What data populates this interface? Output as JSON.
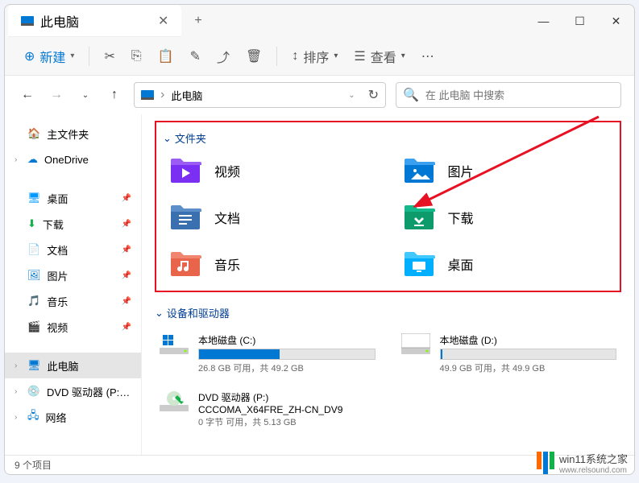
{
  "title": "此电脑",
  "toolbar": {
    "new": "新建",
    "sort": "排序",
    "view": "查看"
  },
  "addressbar": {
    "path": "此电脑",
    "sep": "›"
  },
  "search": {
    "placeholder": "在 此电脑 中搜索"
  },
  "sidebar": {
    "home": "主文件夹",
    "onedrive": "OneDrive",
    "desktop": "桌面",
    "downloads": "下载",
    "documents": "文档",
    "pictures": "图片",
    "music": "音乐",
    "videos": "视频",
    "thispc": "此电脑",
    "dvd": "DVD 驱动器 (P:) C",
    "network": "网络"
  },
  "sections": {
    "folders": "文件夹",
    "devices": "设备和驱动器"
  },
  "folders": {
    "videos": "视频",
    "pictures": "图片",
    "documents": "文档",
    "downloads": "下载",
    "music": "音乐",
    "desktop": "桌面"
  },
  "drives": [
    {
      "name": "本地磁盘 (C:)",
      "info": "26.8 GB 可用，共 49.2 GB",
      "used_pct": 46
    },
    {
      "name": "本地磁盘 (D:)",
      "info": "49.9 GB 可用，共 49.9 GB",
      "used_pct": 1
    },
    {
      "name": "DVD 驱动器 (P:)",
      "label": "CCCOMA_X64FRE_ZH-CN_DV9",
      "info": "0 字节 可用，共 5.13 GB"
    }
  ],
  "statusbar": {
    "items": "9 个项目"
  },
  "watermark": {
    "title": "win11系统之家",
    "url": "www.relsound.com"
  }
}
